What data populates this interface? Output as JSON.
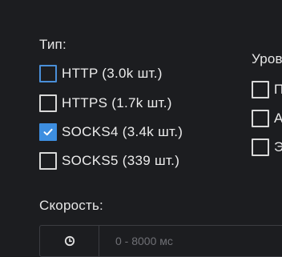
{
  "type_section": {
    "label": "Тип:",
    "options": [
      {
        "label": "HTTP (3.0k шт.)",
        "checked": false
      },
      {
        "label": "HTTPS (1.7k шт.)",
        "checked": false
      },
      {
        "label": "SOCKS4 (3.4k шт.)",
        "checked": true
      },
      {
        "label": "SOCKS5 (339 шт.)",
        "checked": false
      }
    ]
  },
  "level_section": {
    "label": "Уров",
    "options": [
      {
        "label": "П"
      },
      {
        "label": "А"
      },
      {
        "label": "Э"
      }
    ]
  },
  "speed_section": {
    "label": "Скорость:",
    "icon": "clock-icon",
    "placeholder": "0 - 8000 мс"
  },
  "colors": {
    "background": "#1c1d20",
    "accent": "#3d8ee0",
    "focus_border": "#4a8fd8",
    "text": "#ececec",
    "placeholder": "#6f7075"
  }
}
